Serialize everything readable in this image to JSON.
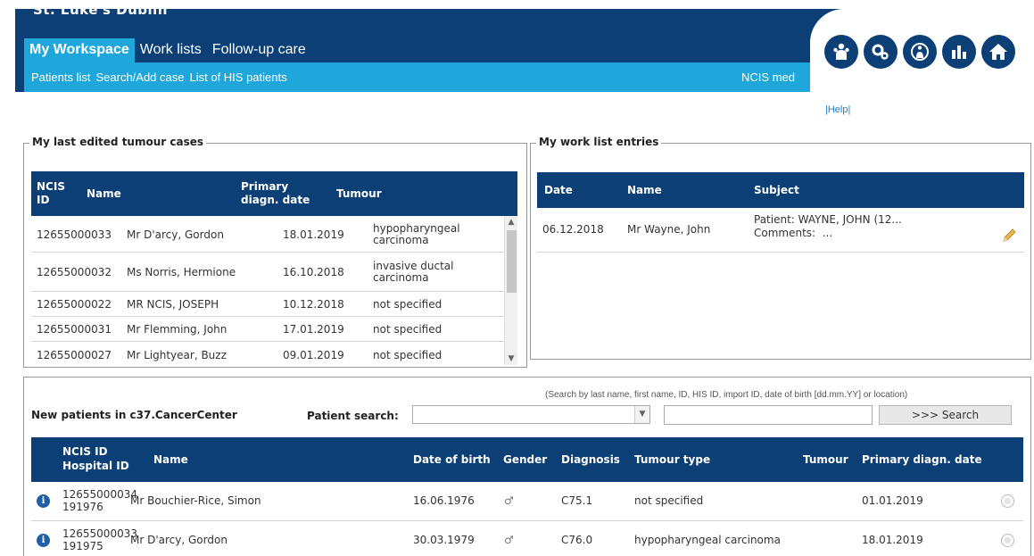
{
  "app": {
    "title": "St. Luke's Dublin"
  },
  "nav": {
    "tabs": [
      "My Workspace",
      "Work lists",
      "Follow-up care"
    ],
    "sub_links": [
      "Patients list",
      "Search/Add case",
      "List of HIS patients"
    ],
    "right_label": "NCIS med",
    "help": "|Help|",
    "icons": [
      "patient-group-icon",
      "settings-gears-icon",
      "patient-info-icon",
      "statistics-chart-icon",
      "home-icon"
    ]
  },
  "tumour_cases": {
    "legend": "My last edited tumour cases",
    "headers": {
      "id": "NCIS ID",
      "name": "Name",
      "date": "Primary diagn. date",
      "tumour": "Tumour"
    },
    "rows": [
      {
        "id": "12655000033",
        "name": "Mr D'arcy, Gordon",
        "date": "18.01.2019",
        "tumour": "hypopharyngeal carcinoma"
      },
      {
        "id": "12655000032",
        "name": "Ms Norris, Hermione",
        "date": "16.10.2018",
        "tumour": "invasive ductal carcinoma"
      },
      {
        "id": "12655000022",
        "name": "MR NCIS, JOSEPH",
        "date": "10.12.2018",
        "tumour": "not specified"
      },
      {
        "id": "12655000031",
        "name": "Mr Flemming, John",
        "date": "17.01.2019",
        "tumour": "not specified"
      },
      {
        "id": "12655000027",
        "name": "Mr Lightyear, Buzz",
        "date": "09.01.2019",
        "tumour": "not specified"
      }
    ]
  },
  "work_list": {
    "legend": "My work list entries",
    "headers": {
      "date": "Date",
      "name": "Name",
      "subject": "Subject"
    },
    "rows": [
      {
        "date": "06.12.2018",
        "name": "Mr Wayne, John",
        "subject_line1": "Patient: WAYNE, JOHN (12...",
        "subject_line2": "Comments:  ..."
      }
    ]
  },
  "new_patients": {
    "title": "New patients in c37.CancerCenter",
    "search_label": "Patient search:",
    "search_hint": "(Search by last name, first name, ID, HIS ID, import ID, date of birth [dd.mm.YY] or location)",
    "search_value": "",
    "search_button": ">>> Search",
    "headers": {
      "id": "NCIS ID",
      "hospital_id": "Hospital ID",
      "name": "Name",
      "dob": "Date of birth",
      "gender": "Gender",
      "diagnosis": "Diagnosis",
      "tumour_type": "Tumour type",
      "tumour": "Tumour",
      "primary_date": "Primary diagn. date"
    },
    "rows": [
      {
        "id": "12655000034",
        "hospital_id": "191976",
        "name": "Mr Bouchier-Rice, Simon",
        "dob": "16.06.1976",
        "gender": "♂",
        "diagnosis": "C75.1",
        "tumour_type": "not specified",
        "primary_date": "01.01.2019"
      },
      {
        "id": "12655000033",
        "hospital_id": "191975",
        "name": "Mr D'arcy, Gordon",
        "dob": "30.03.1979",
        "gender": "♂",
        "diagnosis": "C76.0",
        "tumour_type": "hypopharyngeal carcinoma",
        "primary_date": "18.01.2019"
      }
    ]
  },
  "colors": {
    "navy": "#0b3f76",
    "accent": "#1fa7db"
  }
}
